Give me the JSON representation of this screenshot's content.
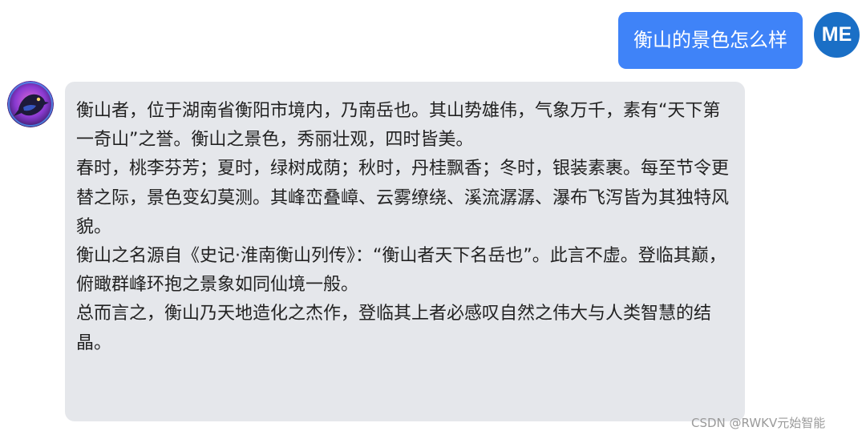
{
  "user_message": {
    "text": "衡山的景色怎么样",
    "avatar_initials": "ME",
    "bubble_color": "#3f83f8",
    "avatar_color": "#1a6fc6"
  },
  "bot_message": {
    "avatar_icon": "raven-bird-icon",
    "bubble_color": "#e5e7eb",
    "paragraphs": [
      "衡山者，位于湖南省衡阳市境内，乃南岳也。其山势雄伟，气象万千，素有“天下第一奇山”之誉。衡山之景色，秀丽壮观，四时皆美。",
      "春时，桃李芬芳；夏时，绿树成荫；秋时，丹桂飘香；冬时，银装素裹。每至节令更替之际，景色变幻莫测。其峰峦叠嶂、云雾缭绕、溪流潺潺、瀑布飞泻皆为其独特风貌。",
      "衡山之名源自《史记·淮南衡山列传》：“衡山者天下名岳也”。此言不虚。登临其巅，俯瞰群峰环抱之景象如同仙境一般。",
      "总而言之，衡山乃天地造化之杰作，登临其上者必感叹自然之伟大与人类智慧的结晶。"
    ]
  },
  "watermark": {
    "text": "CSDN @RWKV元始智能"
  }
}
